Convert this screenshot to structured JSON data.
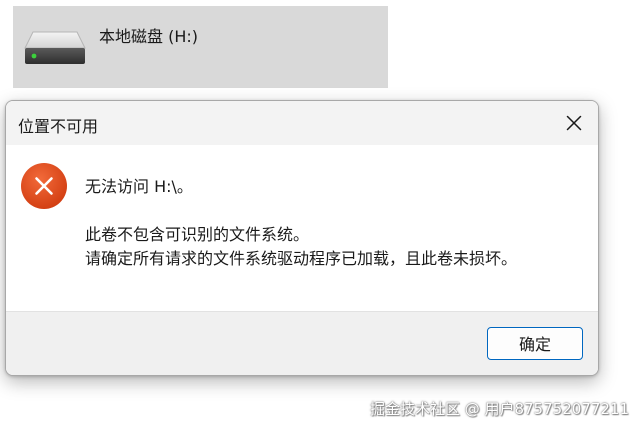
{
  "explorer": {
    "drive_label": "本地磁盘 (H:)",
    "drive_icon": "hard-drive-icon"
  },
  "dialog": {
    "title": "位置不可用",
    "close_icon": "close-icon",
    "error_icon": "error-icon",
    "message_main": "无法访问 H:\\。",
    "message_line1": "此卷不包含可识别的文件系统。",
    "message_line2": "请确定所有请求的文件系统驱动程序已加载，且此卷未损坏。",
    "ok_label": "确定"
  },
  "watermark": {
    "text": "掘金技术社区 @ 用户875752077211"
  },
  "colors": {
    "error_red": "#e2471a",
    "accent_blue": "#0067c0",
    "drive_tile_bg": "#d9d9d9",
    "drive_led": "#3cd13c"
  }
}
